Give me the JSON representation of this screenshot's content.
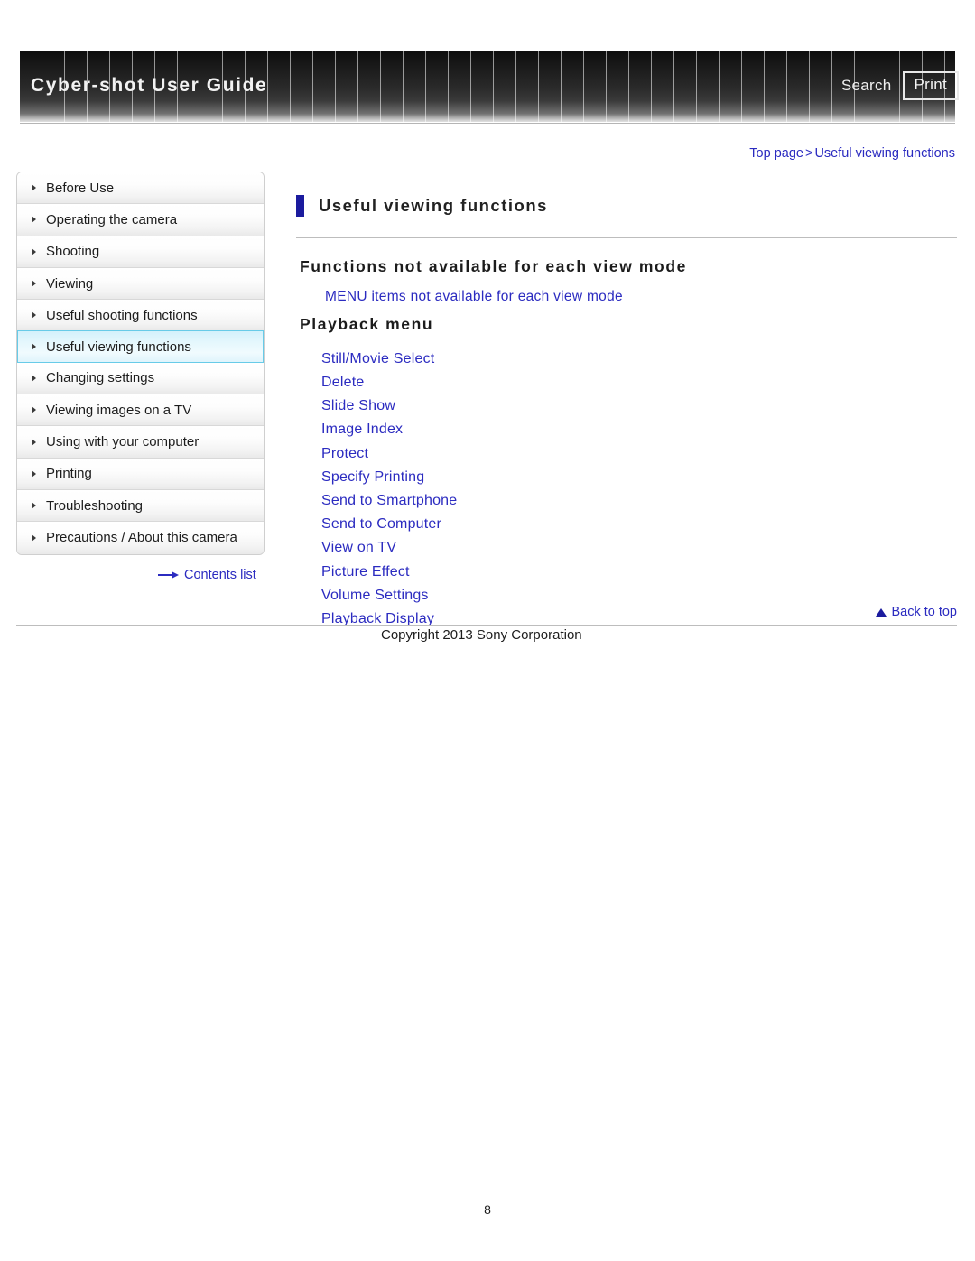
{
  "header": {
    "title": "Cyber-shot User Guide",
    "search_label": "Search",
    "print_label": "Print"
  },
  "breadcrumb": {
    "top_page": "Top page",
    "separator": ">",
    "current": "Useful viewing functions"
  },
  "sidebar": {
    "items": [
      {
        "label": "Before Use",
        "active": false
      },
      {
        "label": "Operating the camera",
        "active": false
      },
      {
        "label": "Shooting",
        "active": false
      },
      {
        "label": "Viewing",
        "active": false
      },
      {
        "label": "Useful shooting functions",
        "active": false
      },
      {
        "label": "Useful viewing functions",
        "active": true
      },
      {
        "label": "Changing settings",
        "active": false
      },
      {
        "label": "Viewing images on a TV",
        "active": false
      },
      {
        "label": "Using with your computer",
        "active": false
      },
      {
        "label": "Printing",
        "active": false
      },
      {
        "label": "Troubleshooting",
        "active": false
      },
      {
        "label": "Precautions / About this camera",
        "active": false
      }
    ],
    "contents_list_label": "Contents list"
  },
  "main": {
    "page_title": "Useful viewing functions",
    "section_heading": "Functions not available for each view mode",
    "section_link": "MENU items not available for each view mode",
    "playback_menu_heading": "Playback menu",
    "menu_links": [
      "Still/Movie Select",
      "Delete",
      "Slide Show",
      "Image Index",
      "Protect",
      "Specify Printing",
      "Send to Smartphone",
      "Send to Computer",
      "View on TV",
      "Picture Effect",
      "Volume Settings",
      "Playback Display"
    ]
  },
  "footer": {
    "back_to_top": "Back to top",
    "copyright": "Copyright 2013 Sony Corporation",
    "page_number": "8"
  },
  "colors": {
    "link_blue": "#2b2bc0",
    "title_marker": "#1b1b9e",
    "active_nav_border": "#67cbe8",
    "header_dark": "#0d0d0d"
  }
}
